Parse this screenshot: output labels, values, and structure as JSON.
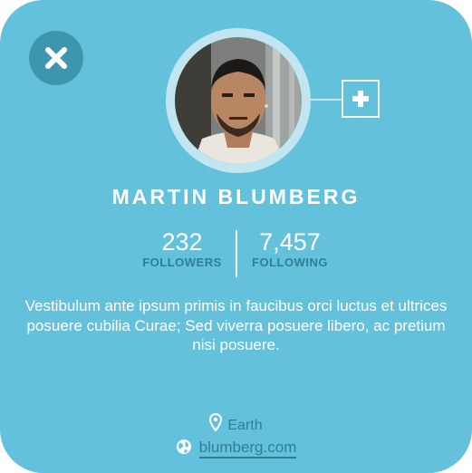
{
  "profile": {
    "name": "MARTIN BLUMBERG",
    "followers": {
      "count": "232",
      "label": "FOLLOWERS"
    },
    "following": {
      "count": "7,457",
      "label": "FOLLOWING"
    },
    "bio": "Vestibulum ante ipsum primis in faucibus orci luctus et ultrices posuere cubilia Curae; Sed viverra posuere libero, ac pretium nisi posuere.",
    "location": "Earth",
    "website": "blumberg.com"
  },
  "icons": {
    "close": "close-icon",
    "add": "plus-icon",
    "location": "map-pin-icon",
    "website": "globe-icon"
  },
  "colors": {
    "card": "#64c1dc",
    "accent_dark": "#2d7f95",
    "close_bg": "#3d96ad",
    "ring": "#c2e6f1",
    "text": "#ffffff"
  }
}
